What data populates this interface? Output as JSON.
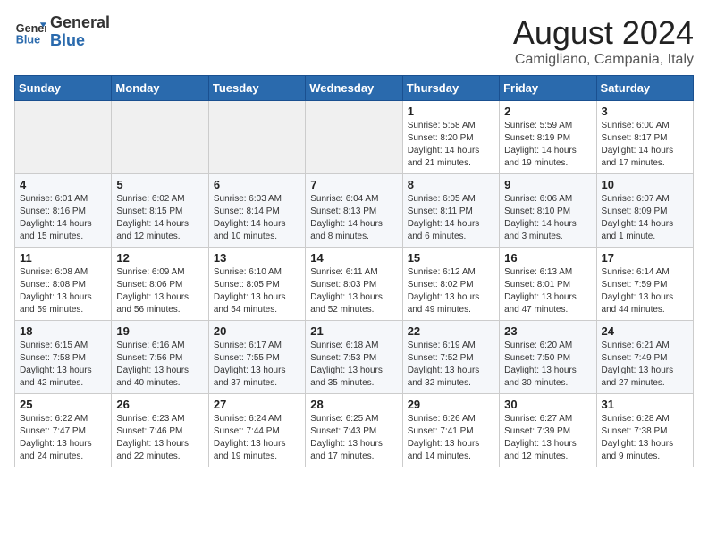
{
  "header": {
    "logo_general": "General",
    "logo_blue": "Blue",
    "month_year": "August 2024",
    "location": "Camigliano, Campania, Italy"
  },
  "days_of_week": [
    "Sunday",
    "Monday",
    "Tuesday",
    "Wednesday",
    "Thursday",
    "Friday",
    "Saturday"
  ],
  "weeks": [
    [
      {
        "day": "",
        "content": ""
      },
      {
        "day": "",
        "content": ""
      },
      {
        "day": "",
        "content": ""
      },
      {
        "day": "",
        "content": ""
      },
      {
        "day": "1",
        "content": "Sunrise: 5:58 AM\nSunset: 8:20 PM\nDaylight: 14 hours\nand 21 minutes."
      },
      {
        "day": "2",
        "content": "Sunrise: 5:59 AM\nSunset: 8:19 PM\nDaylight: 14 hours\nand 19 minutes."
      },
      {
        "day": "3",
        "content": "Sunrise: 6:00 AM\nSunset: 8:17 PM\nDaylight: 14 hours\nand 17 minutes."
      }
    ],
    [
      {
        "day": "4",
        "content": "Sunrise: 6:01 AM\nSunset: 8:16 PM\nDaylight: 14 hours\nand 15 minutes."
      },
      {
        "day": "5",
        "content": "Sunrise: 6:02 AM\nSunset: 8:15 PM\nDaylight: 14 hours\nand 12 minutes."
      },
      {
        "day": "6",
        "content": "Sunrise: 6:03 AM\nSunset: 8:14 PM\nDaylight: 14 hours\nand 10 minutes."
      },
      {
        "day": "7",
        "content": "Sunrise: 6:04 AM\nSunset: 8:13 PM\nDaylight: 14 hours\nand 8 minutes."
      },
      {
        "day": "8",
        "content": "Sunrise: 6:05 AM\nSunset: 8:11 PM\nDaylight: 14 hours\nand 6 minutes."
      },
      {
        "day": "9",
        "content": "Sunrise: 6:06 AM\nSunset: 8:10 PM\nDaylight: 14 hours\nand 3 minutes."
      },
      {
        "day": "10",
        "content": "Sunrise: 6:07 AM\nSunset: 8:09 PM\nDaylight: 14 hours\nand 1 minute."
      }
    ],
    [
      {
        "day": "11",
        "content": "Sunrise: 6:08 AM\nSunset: 8:08 PM\nDaylight: 13 hours\nand 59 minutes."
      },
      {
        "day": "12",
        "content": "Sunrise: 6:09 AM\nSunset: 8:06 PM\nDaylight: 13 hours\nand 56 minutes."
      },
      {
        "day": "13",
        "content": "Sunrise: 6:10 AM\nSunset: 8:05 PM\nDaylight: 13 hours\nand 54 minutes."
      },
      {
        "day": "14",
        "content": "Sunrise: 6:11 AM\nSunset: 8:03 PM\nDaylight: 13 hours\nand 52 minutes."
      },
      {
        "day": "15",
        "content": "Sunrise: 6:12 AM\nSunset: 8:02 PM\nDaylight: 13 hours\nand 49 minutes."
      },
      {
        "day": "16",
        "content": "Sunrise: 6:13 AM\nSunset: 8:01 PM\nDaylight: 13 hours\nand 47 minutes."
      },
      {
        "day": "17",
        "content": "Sunrise: 6:14 AM\nSunset: 7:59 PM\nDaylight: 13 hours\nand 44 minutes."
      }
    ],
    [
      {
        "day": "18",
        "content": "Sunrise: 6:15 AM\nSunset: 7:58 PM\nDaylight: 13 hours\nand 42 minutes."
      },
      {
        "day": "19",
        "content": "Sunrise: 6:16 AM\nSunset: 7:56 PM\nDaylight: 13 hours\nand 40 minutes."
      },
      {
        "day": "20",
        "content": "Sunrise: 6:17 AM\nSunset: 7:55 PM\nDaylight: 13 hours\nand 37 minutes."
      },
      {
        "day": "21",
        "content": "Sunrise: 6:18 AM\nSunset: 7:53 PM\nDaylight: 13 hours\nand 35 minutes."
      },
      {
        "day": "22",
        "content": "Sunrise: 6:19 AM\nSunset: 7:52 PM\nDaylight: 13 hours\nand 32 minutes."
      },
      {
        "day": "23",
        "content": "Sunrise: 6:20 AM\nSunset: 7:50 PM\nDaylight: 13 hours\nand 30 minutes."
      },
      {
        "day": "24",
        "content": "Sunrise: 6:21 AM\nSunset: 7:49 PM\nDaylight: 13 hours\nand 27 minutes."
      }
    ],
    [
      {
        "day": "25",
        "content": "Sunrise: 6:22 AM\nSunset: 7:47 PM\nDaylight: 13 hours\nand 24 minutes."
      },
      {
        "day": "26",
        "content": "Sunrise: 6:23 AM\nSunset: 7:46 PM\nDaylight: 13 hours\nand 22 minutes."
      },
      {
        "day": "27",
        "content": "Sunrise: 6:24 AM\nSunset: 7:44 PM\nDaylight: 13 hours\nand 19 minutes."
      },
      {
        "day": "28",
        "content": "Sunrise: 6:25 AM\nSunset: 7:43 PM\nDaylight: 13 hours\nand 17 minutes."
      },
      {
        "day": "29",
        "content": "Sunrise: 6:26 AM\nSunset: 7:41 PM\nDaylight: 13 hours\nand 14 minutes."
      },
      {
        "day": "30",
        "content": "Sunrise: 6:27 AM\nSunset: 7:39 PM\nDaylight: 13 hours\nand 12 minutes."
      },
      {
        "day": "31",
        "content": "Sunrise: 6:28 AM\nSunset: 7:38 PM\nDaylight: 13 hours\nand 9 minutes."
      }
    ]
  ]
}
